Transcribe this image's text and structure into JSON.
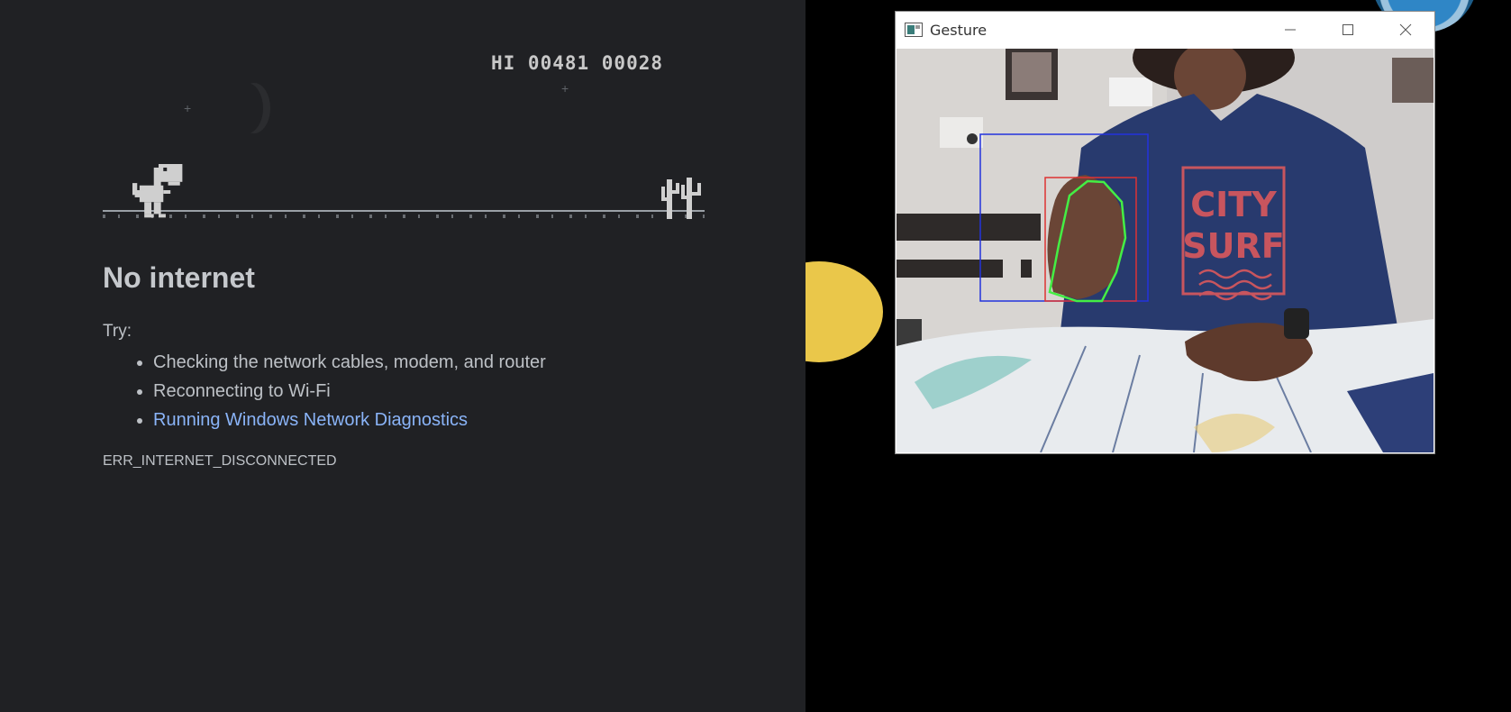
{
  "offline_page": {
    "score_text": "HI 00481 00028",
    "title": "No internet",
    "try_label": "Try:",
    "suggestions": [
      "Checking the network cables, modem, and router",
      "Reconnecting to Wi-Fi"
    ],
    "diagnostics_link": "Running Windows Network Diagnostics",
    "error_code": "ERR_INTERNET_DISCONNECTED"
  },
  "gesture_window": {
    "title": "Gesture",
    "shirt_text_line1": "CITY",
    "shirt_text_line2": "SURF"
  },
  "colors": {
    "page_bg": "#202124",
    "link": "#8ab4f8",
    "accent_yellow": "#eac74a",
    "bbox_blue": "#2233dd",
    "bbox_red": "#dd3333",
    "contour_green": "#44ee44"
  },
  "icons": [
    "dino-icon",
    "cactus-icon",
    "app-icon",
    "minimize-icon",
    "maximize-icon",
    "close-icon"
  ]
}
